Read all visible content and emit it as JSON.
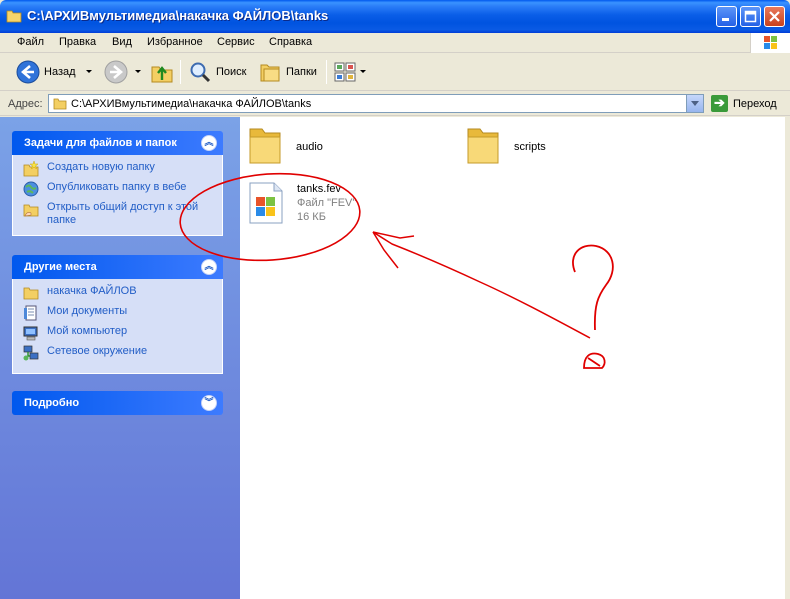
{
  "window": {
    "title": "C:\\АРХИВмультимедиа\\накачка ФАЙЛОВ\\tanks"
  },
  "menu": [
    "Файл",
    "Правка",
    "Вид",
    "Избранное",
    "Сервис",
    "Справка"
  ],
  "toolbar": {
    "back_label": "Назад",
    "search_label": "Поиск",
    "folders_label": "Папки"
  },
  "address": {
    "label": "Адрес:",
    "value": "C:\\АРХИВмультимедиа\\накачка ФАЙЛОВ\\tanks",
    "go_label": "Переход"
  },
  "tasks_panel": {
    "title": "Задачи для файлов и папок",
    "items": [
      {
        "label": "Создать новую папку",
        "icon": "new-folder-icon"
      },
      {
        "label": "Опубликовать папку в вебе",
        "icon": "publish-web-icon"
      },
      {
        "label": "Открыть общий доступ к этой папке",
        "icon": "share-folder-icon"
      }
    ]
  },
  "places_panel": {
    "title": "Другие места",
    "items": [
      {
        "label": "накачка ФАЙЛОВ",
        "icon": "folder-icon"
      },
      {
        "label": "Мои документы",
        "icon": "my-documents-icon"
      },
      {
        "label": "Мой компьютер",
        "icon": "my-computer-icon"
      },
      {
        "label": "Сетевое окружение",
        "icon": "network-icon"
      }
    ]
  },
  "details_panel": {
    "title": "Подробно"
  },
  "files": [
    {
      "name": "audio",
      "kind": "folder"
    },
    {
      "name": "scripts",
      "kind": "folder"
    },
    {
      "name": "tanks.fev",
      "kind": "file",
      "type": "Файл \"FEV\"",
      "size": "16 КБ"
    }
  ],
  "colors": {
    "annotation": "#e00000",
    "titlebar": "#0a5ee8",
    "link": "#215dc6"
  }
}
